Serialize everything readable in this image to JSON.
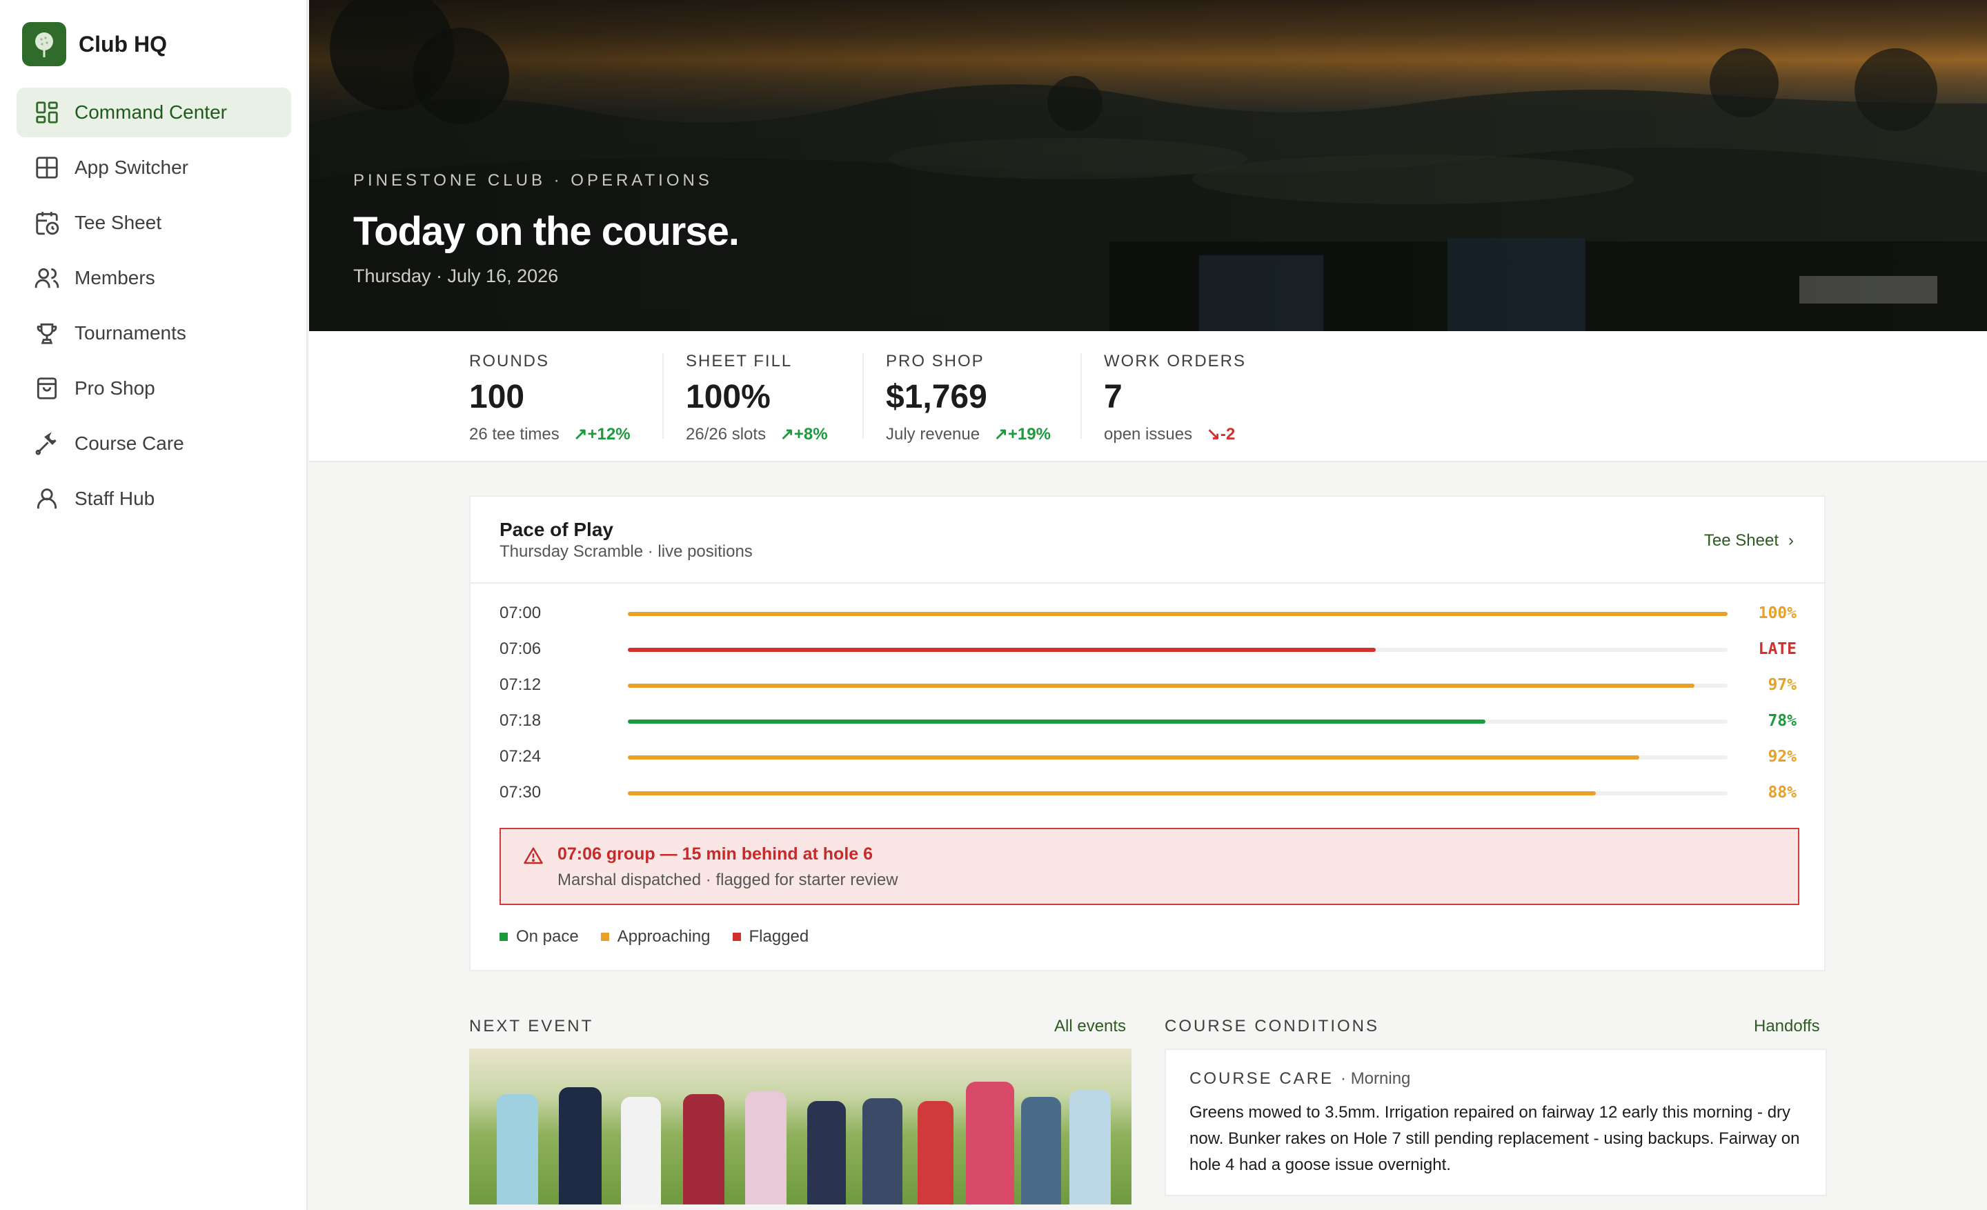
{
  "app": {
    "name": "Club HQ"
  },
  "sidebar": {
    "items": [
      {
        "label": "Command Center",
        "icon": "dashboard-icon",
        "active": true
      },
      {
        "label": "App Switcher",
        "icon": "grid-icon",
        "active": false
      },
      {
        "label": "Tee Sheet",
        "icon": "calendar-clock-icon",
        "active": false
      },
      {
        "label": "Members",
        "icon": "users-icon",
        "active": false
      },
      {
        "label": "Tournaments",
        "icon": "trophy-icon",
        "active": false
      },
      {
        "label": "Pro Shop",
        "icon": "shopping-bag-icon",
        "active": false
      },
      {
        "label": "Course Care",
        "icon": "wrench-icon",
        "active": false
      },
      {
        "label": "Staff Hub",
        "icon": "user-icon",
        "active": false
      }
    ]
  },
  "hero": {
    "eyebrow": "PINESTONE CLUB · OPERATIONS",
    "title": "Today on the course.",
    "date": "Thursday · July 16, 2026"
  },
  "kpis": [
    {
      "label": "ROUNDS",
      "value": "100",
      "sub": "26 tee times",
      "trend": "+12%",
      "direction": "up"
    },
    {
      "label": "SHEET FILL",
      "value": "100%",
      "sub": "26/26 slots",
      "trend": "+8%",
      "direction": "up"
    },
    {
      "label": "PRO SHOP",
      "value": "$1,769",
      "sub": "July revenue",
      "trend": "+19%",
      "direction": "up"
    },
    {
      "label": "WORK ORDERS",
      "value": "7",
      "sub": "open issues",
      "trend": "-2",
      "direction": "down"
    }
  ],
  "pace": {
    "title": "Pace of Play",
    "subtitle": "Thursday Scramble · live positions",
    "link": "Tee Sheet",
    "rows": [
      {
        "time": "07:00",
        "progress": 100,
        "label": "100%",
        "status": "approaching"
      },
      {
        "time": "07:06",
        "progress": 68,
        "label": "LATE",
        "status": "flagged"
      },
      {
        "time": "07:12",
        "progress": 97,
        "label": "97%",
        "status": "approaching"
      },
      {
        "time": "07:18",
        "progress": 78,
        "label": "78%",
        "status": "on-pace"
      },
      {
        "time": "07:24",
        "progress": 92,
        "label": "92%",
        "status": "approaching"
      },
      {
        "time": "07:30",
        "progress": 88,
        "label": "88%",
        "status": "approaching"
      }
    ],
    "alert": {
      "title": "07:06 group — 15 min behind at hole 6",
      "detail": "Marshal dispatched · flagged for starter review"
    },
    "legend": [
      {
        "label": "On pace",
        "status": "on-pace"
      },
      {
        "label": "Approaching",
        "status": "approaching"
      },
      {
        "label": "Flagged",
        "status": "flagged"
      }
    ]
  },
  "colors": {
    "on-pace": "#1e9a3e",
    "approaching": "#e8a126",
    "flagged": "#d22f2f",
    "accent": "#2f6b2b"
  },
  "next_event": {
    "label": "NEXT EVENT",
    "link": "All events"
  },
  "conditions": {
    "label": "COURSE CONDITIONS",
    "link": "Handoffs",
    "card_tag": "COURSE CARE",
    "card_time": "· Morning",
    "card_text": "Greens mowed to 3.5mm. Irrigation repaired on fairway 12 early this morning - dry now. Bunker rakes on Hole 7 still pending replacement - using backups. Fairway on hole 4 had a goose issue overnight."
  }
}
